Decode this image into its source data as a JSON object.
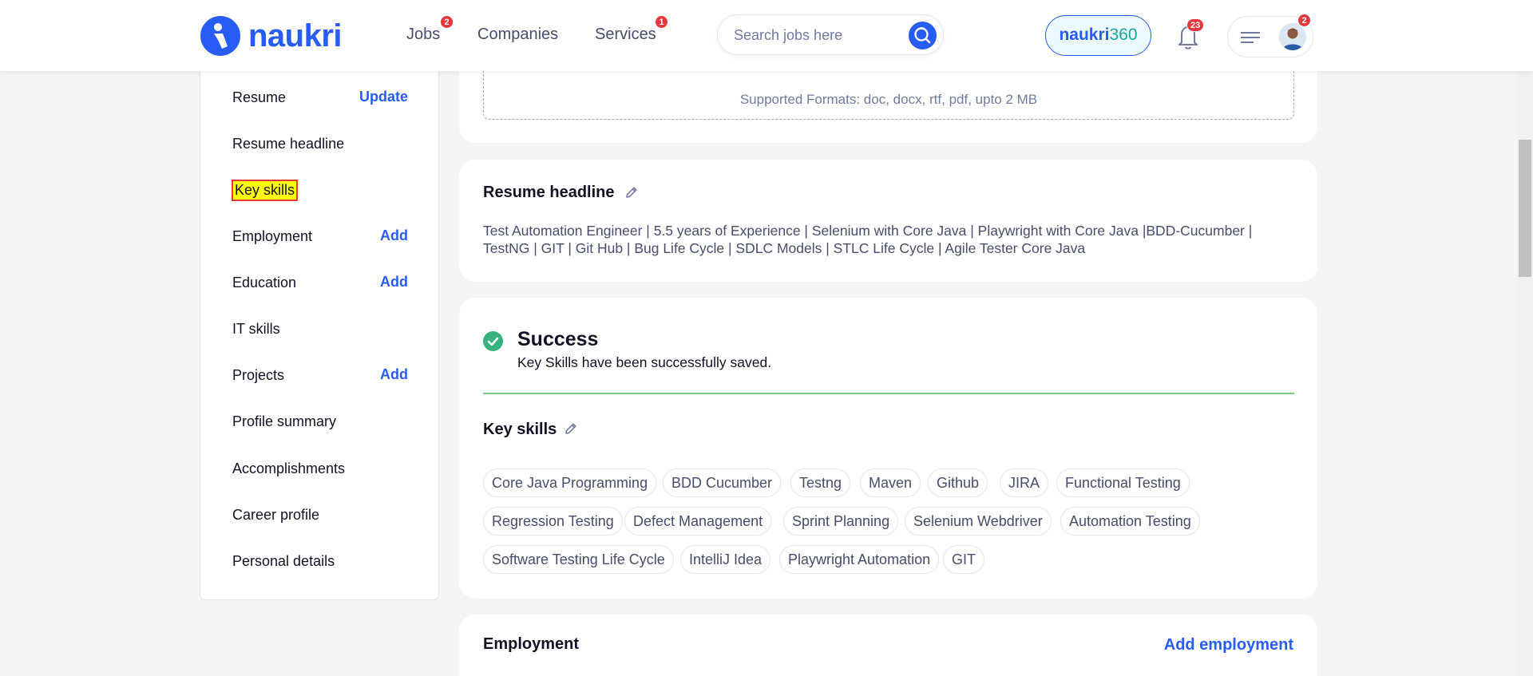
{
  "header": {
    "logo_text": "naukri",
    "nav": [
      {
        "label": "Jobs",
        "badge": "2"
      },
      {
        "label": "Companies"
      },
      {
        "label": "Services",
        "badge": "1"
      }
    ],
    "search_placeholder": "Search jobs here",
    "naukri360_a": "naukri",
    "naukri360_b": "360",
    "notification_count": "23",
    "menu_badge": "2"
  },
  "sidebar": {
    "items": [
      {
        "label": "Resume",
        "action": "Update"
      },
      {
        "label": "Resume headline",
        "action": ""
      },
      {
        "label": "Key skills",
        "action": ""
      },
      {
        "label": "Employment",
        "action": "Add"
      },
      {
        "label": "Education",
        "action": "Add"
      },
      {
        "label": "IT skills",
        "action": ""
      },
      {
        "label": "Projects",
        "action": "Add"
      },
      {
        "label": "Profile summary",
        "action": ""
      },
      {
        "label": "Accomplishments",
        "action": ""
      },
      {
        "label": "Career profile",
        "action": ""
      },
      {
        "label": "Personal details",
        "action": ""
      }
    ]
  },
  "upload": {
    "formats": "Supported Formats: doc, docx, rtf, pdf, upto 2 MB"
  },
  "resume_headline": {
    "title": "Resume headline",
    "text": "Test Automation Engineer | 5.5 years of Experience | Selenium with Core Java | Playwright with Core Java |BDD-Cucumber | TestNG | GIT | Git Hub | Bug Life Cycle | SDLC Models | STLC Life Cycle | Agile Tester Core Java"
  },
  "success": {
    "title": "Success",
    "message": "Key Skills have been successfully saved."
  },
  "key_skills": {
    "title": "Key skills",
    "skills": [
      "Core Java Programming",
      "BDD Cucumber",
      "Testng",
      "Maven",
      "Github",
      "JIRA",
      "Functional Testing",
      "Regression Testing",
      "Defect Management",
      "Sprint Planning",
      "Selenium Webdriver",
      "Automation Testing",
      "Software Testing Life Cycle",
      "IntelliJ Idea",
      "Playwright Automation",
      "GIT"
    ]
  },
  "employment": {
    "title": "Employment",
    "add_label": "Add employment"
  },
  "colors": {
    "brand": "#275df5",
    "success": "#36b37e",
    "badge": "#e5393d",
    "highlight": "#ffff00"
  }
}
